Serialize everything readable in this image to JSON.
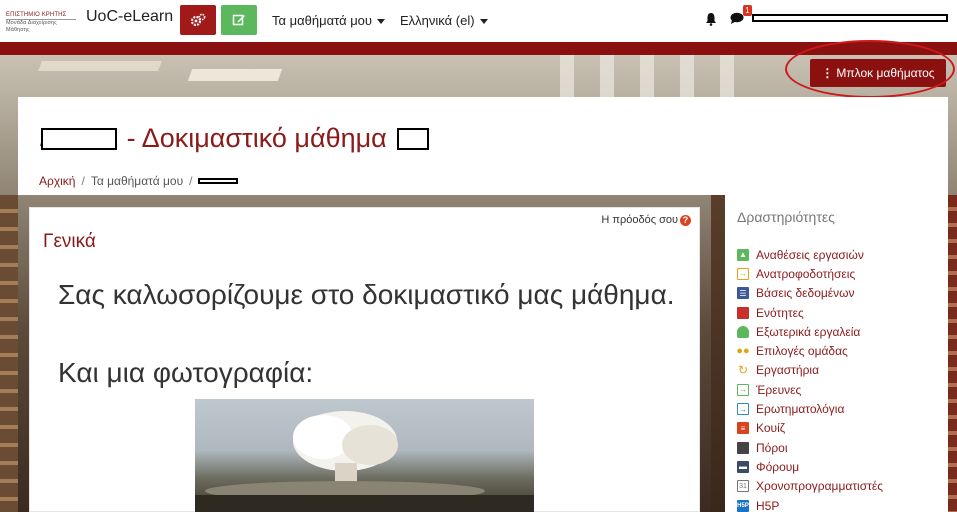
{
  "navbar": {
    "logo_line1": "ΕΠΙΣΤΗΜΙΟ ΚΡΗΤΗΣ",
    "logo_line2": "Μονάδα Διαχείρισης Μάθησης",
    "brand": "UoC-eLearn",
    "my_courses": "Τα μαθήματά μου",
    "language": "Ελληνικά (el)",
    "message_count": "1",
    "colors": {
      "gear_button": "#a11919",
      "edit_button": "#5cb85c"
    }
  },
  "banner": {
    "block_button_label": "Μπλοκ μαθήματος",
    "accent_color": "#8b1111"
  },
  "course": {
    "title_middle": "- Δοκιμαστικό μάθημα",
    "breadcrumb": {
      "home": "Αρχική",
      "my_courses": "Τα μαθήματά μου",
      "separator": "/"
    }
  },
  "main": {
    "progress_label": "Η πρόοδός σου",
    "progress_icon": "?",
    "section_title": "Γενικά",
    "welcome_text": "Σας καλωσορίζουμε στο δοκιμαστικό μας μάθημα.",
    "photo_caption": "Και μια φωτογραφία:"
  },
  "activities": {
    "title": "Δραστηριότητες",
    "items": [
      {
        "label": "Αναθέσεις εργασιών",
        "icon": "assignment-icon",
        "color": "#5cb85c"
      },
      {
        "label": "Ανατροφοδοτήσεις",
        "icon": "feedback-icon",
        "color": "#e3a21a"
      },
      {
        "label": "Βάσεις δεδομένων",
        "icon": "database-icon",
        "color": "#3b5998"
      },
      {
        "label": "Ενότητες",
        "icon": "book-icon",
        "color": "#c9302c"
      },
      {
        "label": "Εξωτερικά εργαλεία",
        "icon": "puzzle-icon",
        "color": "#5cb85c"
      },
      {
        "label": "Επιλογές ομάδας",
        "icon": "group-icon",
        "color": "#e3a21a"
      },
      {
        "label": "Εργαστήρια",
        "icon": "workshop-icon",
        "color": "#e3a21a"
      },
      {
        "label": "Έρευνες",
        "icon": "survey-icon",
        "color": "#5cb85c"
      },
      {
        "label": "Ερωτηματολόγια",
        "icon": "questionnaire-icon",
        "color": "#2a8fbd"
      },
      {
        "label": "Κουίζ",
        "icon": "quiz-icon",
        "color": "#d9431f"
      },
      {
        "label": "Πόροι",
        "icon": "resource-icon",
        "color": "#444444"
      },
      {
        "label": "Φόρουμ",
        "icon": "forum-icon",
        "color": "#3b4b66"
      },
      {
        "label": "Χρονοπρογραμματιστές",
        "icon": "scheduler-icon",
        "color": "#777777"
      },
      {
        "label": "H5P",
        "icon": "h5p-icon",
        "color": "#1a73c9"
      }
    ]
  }
}
